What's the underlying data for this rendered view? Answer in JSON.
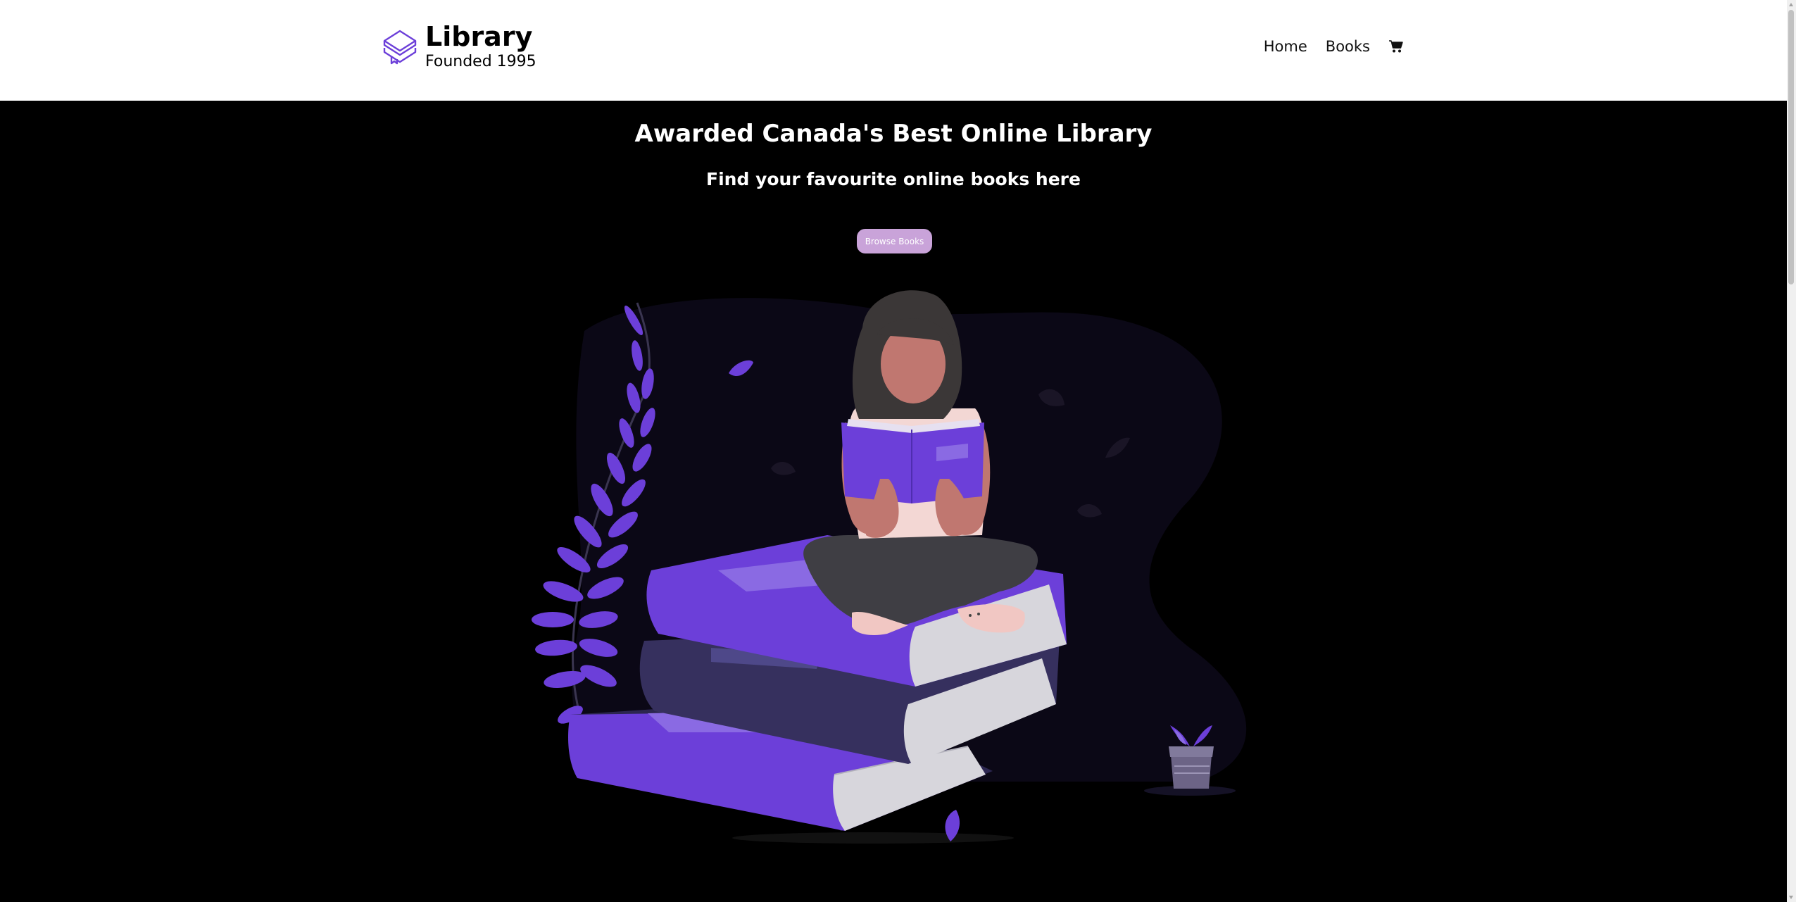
{
  "brand": {
    "title": "Library",
    "subtitle": "Founded 1995",
    "logo_icon": "stacked-books-icon",
    "logo_color": "#6c3fd9"
  },
  "nav": {
    "links": [
      "Home",
      "Books"
    ],
    "cart_icon": "shopping-cart-icon"
  },
  "hero": {
    "title": "Awarded Canada's Best Online Library",
    "subtitle": "Find your favourite online books here",
    "button_label": "Browse Books",
    "button_color": "#c9a3d9"
  },
  "colors": {
    "background": "#000000",
    "header_background": "#ffffff",
    "accent": "#6c3fd9"
  }
}
